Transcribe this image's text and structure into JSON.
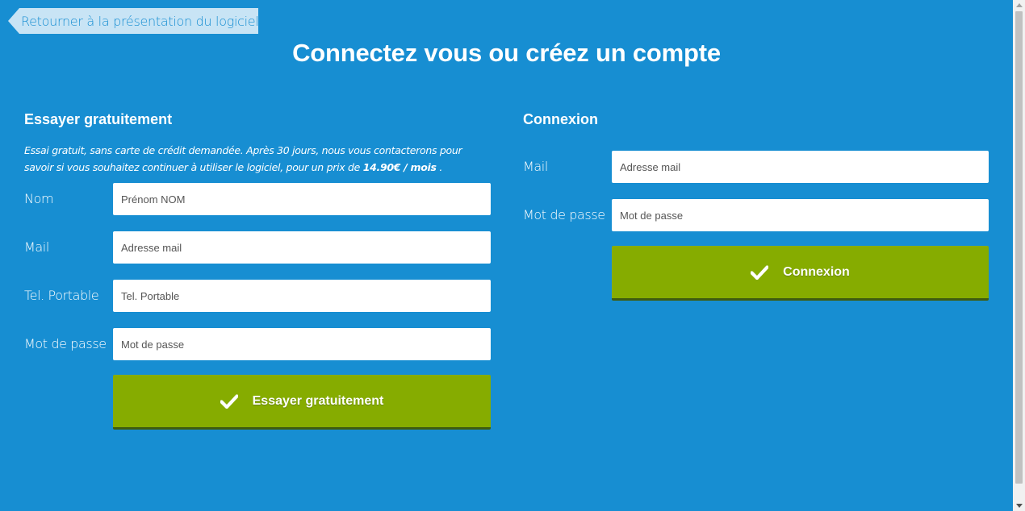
{
  "back_link": {
    "label": "Retourner à la présentation du logiciel"
  },
  "page_title": "Connectez vous ou créez un compte",
  "signup": {
    "title": "Essayer gratuitement",
    "intro_text": "Essai gratuit, sans carte de crédit demandée. Après 30 jours, nous vous contacterons pour savoir si vous souhaitez continuer à utiliser le logiciel, pour un prix de ",
    "intro_price": "14.90€ / mois",
    "intro_end": " .",
    "fields": [
      {
        "label": "Nom",
        "placeholder": "Prénom NOM",
        "value": ""
      },
      {
        "label": "Mail",
        "placeholder": "Adresse mail",
        "value": ""
      },
      {
        "label": "Tel. Portable",
        "placeholder": "Tel. Portable",
        "value": ""
      },
      {
        "label": "Mot de passe",
        "placeholder": "Mot de passe",
        "value": ""
      }
    ],
    "submit_label": "Essayer gratuitement",
    "submit_icon": "check-icon"
  },
  "login": {
    "title": "Connexion",
    "fields": [
      {
        "label": "Mail",
        "placeholder": "Adresse mail",
        "value": ""
      },
      {
        "label": "Mot de passe",
        "placeholder": "Mot de passe",
        "value": ""
      }
    ],
    "submit_label": "Connexion",
    "submit_icon": "check-icon"
  },
  "colors": {
    "background": "#178ed2",
    "button": "#86ac00",
    "back_link_bg": "#c8e4f5"
  }
}
